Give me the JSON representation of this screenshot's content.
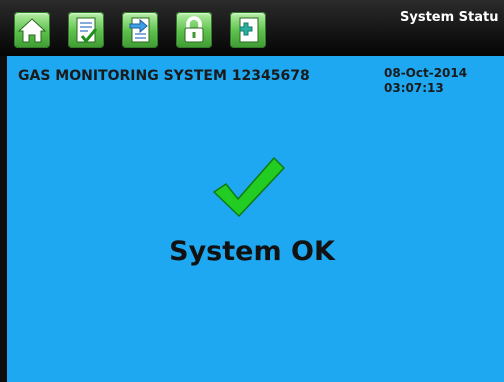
{
  "header": {
    "title": "System Statu"
  },
  "toolbar": {
    "buttons": [
      {
        "name": "home",
        "icon": "home-icon"
      },
      {
        "name": "checklist",
        "icon": "checklist-icon"
      },
      {
        "name": "transfer",
        "icon": "document-transfer-icon"
      },
      {
        "name": "lock",
        "icon": "lock-icon"
      },
      {
        "name": "add",
        "icon": "add-icon"
      }
    ]
  },
  "info": {
    "system_name": "GAS MONITORING SYSTEM 12345678",
    "date": "08-Oct-2014",
    "time": "03:07:13"
  },
  "status": {
    "text": "System OK",
    "icon": "checkmark-icon",
    "color": "#22cc22"
  },
  "colors": {
    "background": "#1ea8f2",
    "toolbar": "#101010",
    "button": "#5cbf4a"
  }
}
